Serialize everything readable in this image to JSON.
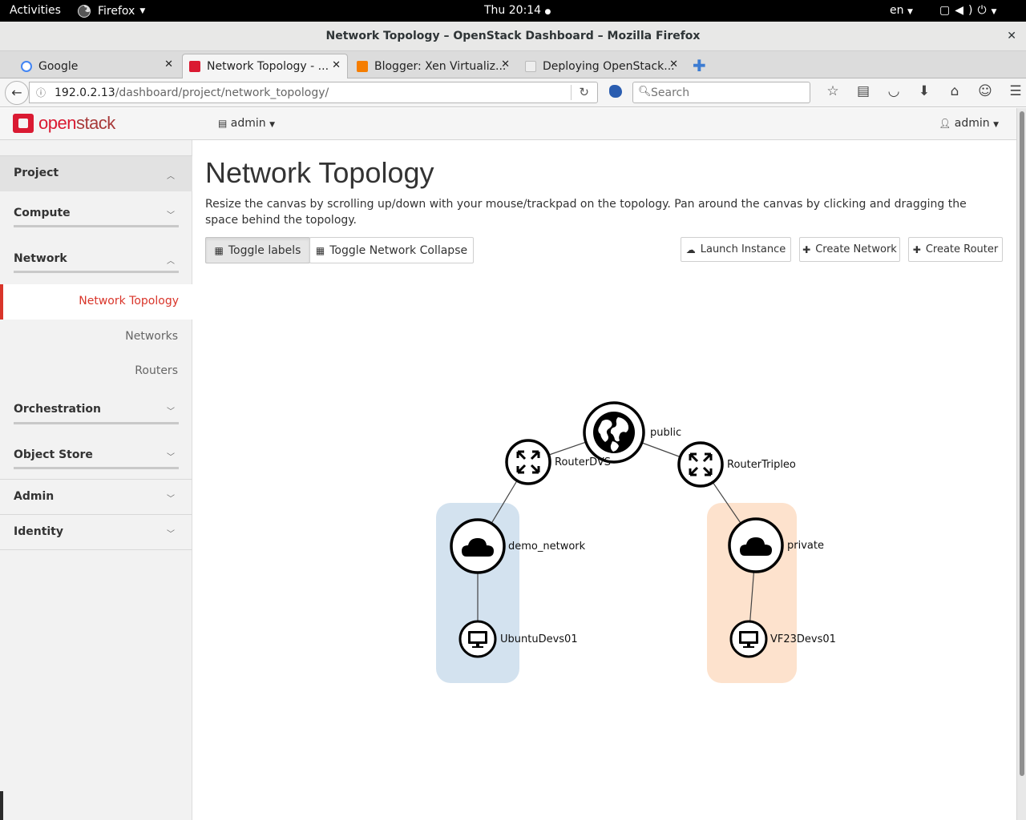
{
  "system_bar": {
    "activities": "Activities",
    "app_menu": "Firefox",
    "clock": "Thu 20:14",
    "language": "en"
  },
  "window": {
    "title": "Network Topology – OpenStack Dashboard – Mozilla Firefox"
  },
  "tabs": [
    {
      "title": "Google",
      "favicon": "google-icon",
      "color": "#4285f4"
    },
    {
      "title": "Network Topology - ...",
      "favicon": "openstack-icon",
      "color": "#da1a32",
      "active": true
    },
    {
      "title": "Blogger: Xen Virtualiz...",
      "favicon": "blogger-icon",
      "color": "#f57d00"
    },
    {
      "title": "Deploying OpenStack...",
      "favicon": "page-icon",
      "color": "#bbbbbb"
    }
  ],
  "address_bar": {
    "host": "192.0.2.13",
    "path": "/dashboard/project/network_topology/"
  },
  "search_bar": {
    "placeholder": "Search"
  },
  "header": {
    "logo_text_a": "open",
    "logo_text_b": "stack",
    "project": "admin",
    "user": "admin"
  },
  "sidebar": {
    "project": "Project",
    "compute": "Compute",
    "network": "Network",
    "network_topology": "Network Topology",
    "networks": "Networks",
    "routers": "Routers",
    "orchestration": "Orchestration",
    "object_store": "Object Store",
    "admin": "Admin",
    "identity": "Identity"
  },
  "main": {
    "title": "Network Topology",
    "description": "Resize the canvas by scrolling up/down with your mouse/trackpad on the topology. Pan around the canvas by clicking and dragging the space behind the topology.",
    "toggle_labels": "Toggle labels",
    "toggle_collapse": "Toggle Network Collapse",
    "launch_instance": "Launch Instance",
    "create_network": "Create Network",
    "create_router": "Create Router"
  },
  "topology": {
    "public_network": "public",
    "router_a": "RouterDVS",
    "router_b": "RouterTripleo",
    "network_a": "demo_network",
    "network_b": "private",
    "instance_a": "UbuntuDevs01",
    "instance_b": "VF23Devs01",
    "network_a_color": "#d3e2ef",
    "network_b_color": "#fde2cd",
    "accent": "#d9352a"
  }
}
